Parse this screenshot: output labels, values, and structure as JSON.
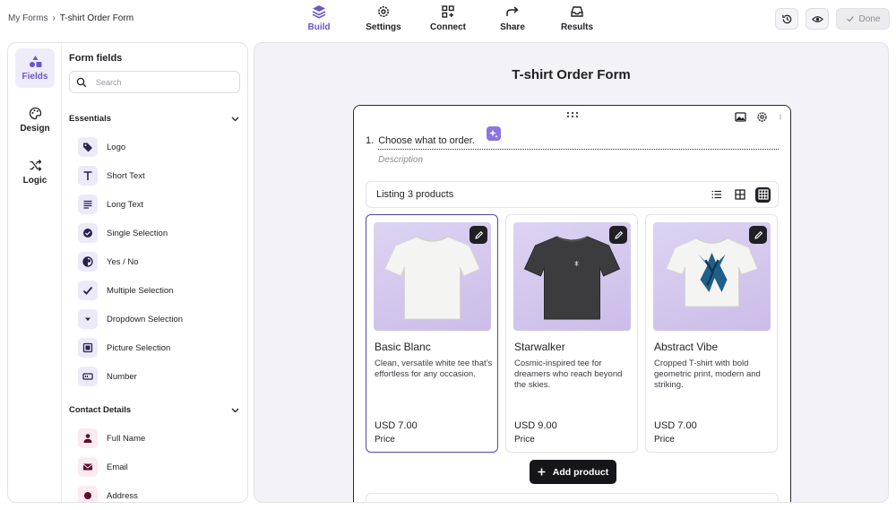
{
  "breadcrumb": {
    "root": "My Forms",
    "separator": "›",
    "current": "T-shirt Order Form"
  },
  "nav_tabs": [
    {
      "label": "Build",
      "icon": "layers-icon",
      "active": true
    },
    {
      "label": "Settings",
      "icon": "gear-icon",
      "active": false
    },
    {
      "label": "Connect",
      "icon": "connect-icon",
      "active": false
    },
    {
      "label": "Share",
      "icon": "share-icon",
      "active": false
    },
    {
      "label": "Results",
      "icon": "inbox-icon",
      "active": false
    }
  ],
  "top_actions": {
    "history_icon": "history-icon",
    "preview_icon": "eye-icon",
    "done_label": "Done"
  },
  "rail": [
    {
      "label": "Fields",
      "icon": "shapes-icon",
      "active": true
    },
    {
      "label": "Design",
      "icon": "palette-icon",
      "active": false
    },
    {
      "label": "Logic",
      "icon": "shuffle-icon",
      "active": false
    }
  ],
  "fields_panel": {
    "title": "Form fields",
    "search_placeholder": "Search",
    "essentials": {
      "label": "Essentials",
      "items": [
        {
          "label": "Logo",
          "icon": "tag-icon"
        },
        {
          "label": "Short Text",
          "icon": "text-t-icon"
        },
        {
          "label": "Long Text",
          "icon": "paragraph-icon"
        },
        {
          "label": "Single Selection",
          "icon": "check-circle-icon"
        },
        {
          "label": "Yes / No",
          "icon": "half-circle-icon"
        },
        {
          "label": "Multiple Selection",
          "icon": "check-icon"
        },
        {
          "label": "Dropdown Selection",
          "icon": "dropdown-icon"
        },
        {
          "label": "Picture Selection",
          "icon": "picture-icon"
        },
        {
          "label": "Number",
          "icon": "number-icon"
        }
      ]
    },
    "contact": {
      "label": "Contact Details",
      "items": [
        {
          "label": "Full Name",
          "icon": "person-icon"
        },
        {
          "label": "Email",
          "icon": "mail-icon"
        },
        {
          "label": "Address",
          "icon": "location-icon"
        }
      ]
    }
  },
  "form": {
    "title": "T-shirt Order Form",
    "question": {
      "number": "1.",
      "text": "Choose what to order.",
      "description_placeholder": "Description",
      "listing_label": "Listing 3 products",
      "view_modes": [
        "list-view-icon",
        "grid-view-icon",
        "table-view-icon"
      ],
      "products": [
        {
          "name": "Basic Blanc",
          "description": "Clean, versatile white tee that’s effortless for any occasion.",
          "price": "USD 7.00",
          "price_label": "Price",
          "shirt_color": "#f4f4f2",
          "selected": true
        },
        {
          "name": "Starwalker",
          "description": "Cosmic-inspired tee for dreamers who reach beyond the skies.",
          "price": "USD 9.00",
          "price_label": "Price",
          "shirt_color": "#3c3c3e",
          "selected": false
        },
        {
          "name": "Abstract Vibe",
          "description": "Cropped T-shirt with bold geometric print, modern and striking.",
          "price": "USD 7.00",
          "price_label": "Price",
          "shirt_color": "#f4f4f2",
          "selected": false
        }
      ],
      "add_product_label": "Add product"
    }
  },
  "colors": {
    "accent": "#6d55c9",
    "canvas_bg": "#f2f2f8",
    "dark": "#1f1f24"
  }
}
